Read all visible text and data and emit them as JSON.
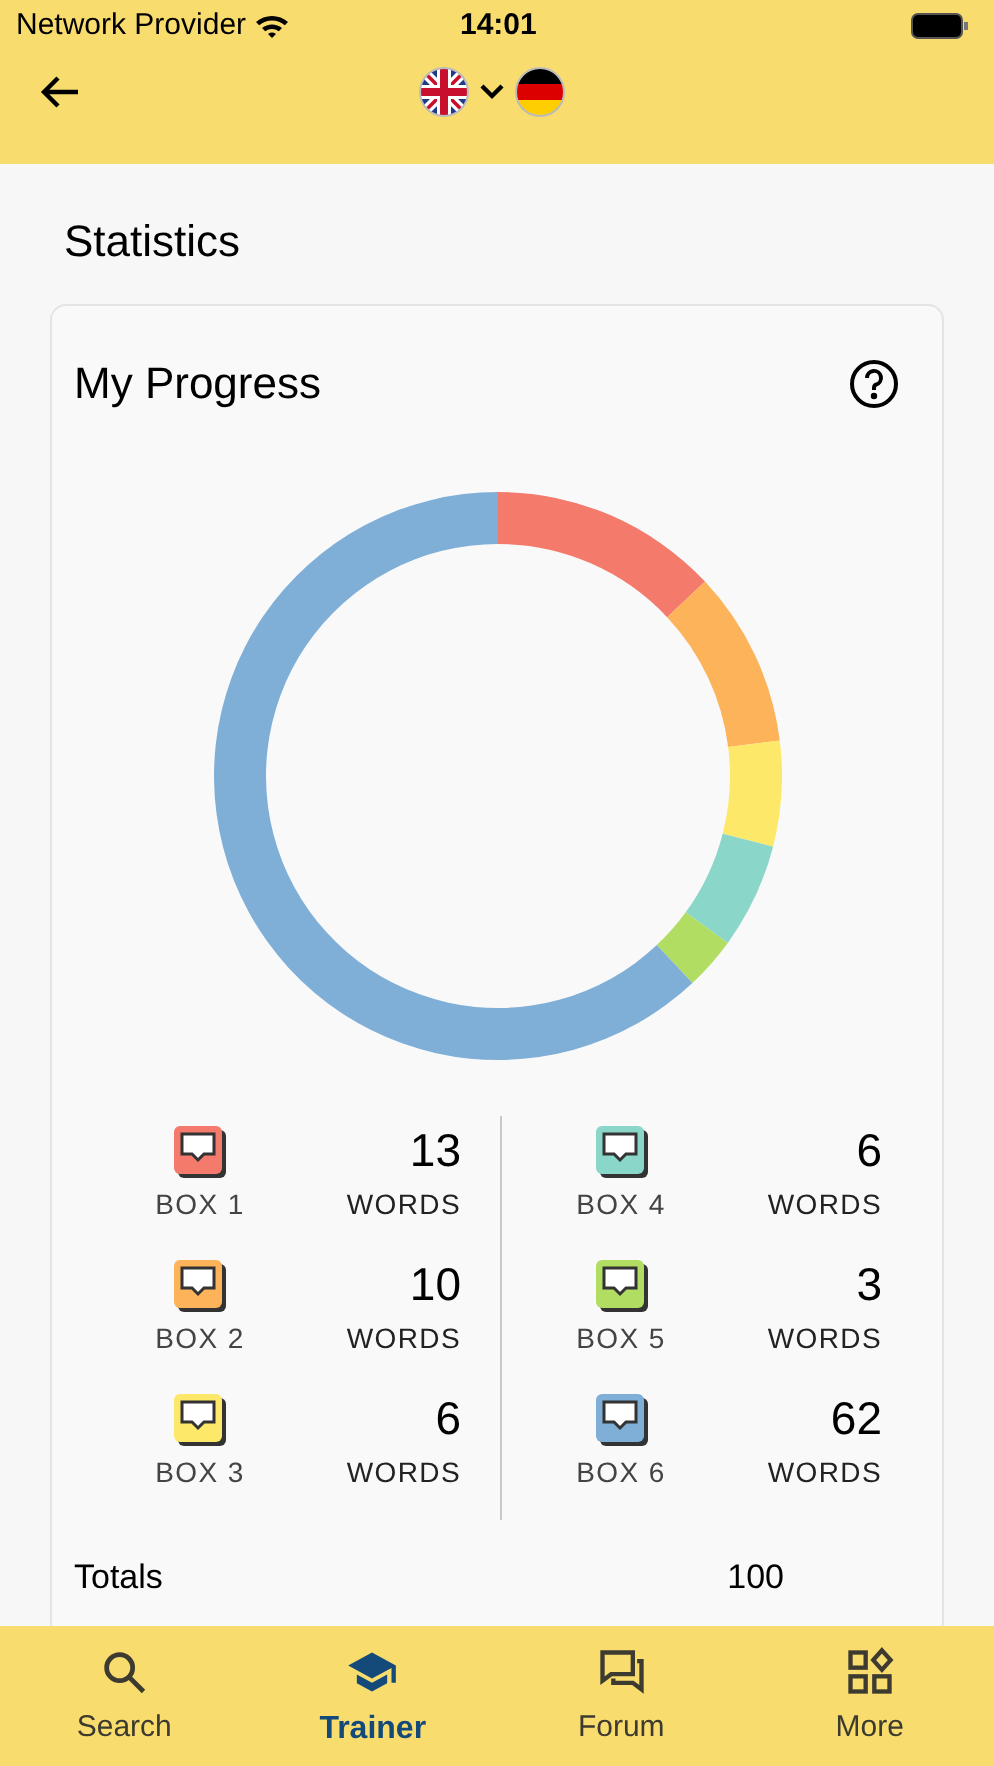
{
  "status_bar": {
    "carrier": "Network Provider",
    "time": "14:01"
  },
  "page_title": "Statistics",
  "card": {
    "title": "My Progress",
    "chart_data": {
      "type": "donut",
      "categories": [
        "BOX 1",
        "BOX 2",
        "BOX 3",
        "BOX 4",
        "BOX 5",
        "BOX 6"
      ],
      "values": [
        13,
        10,
        6,
        6,
        3,
        62
      ]
    },
    "boxes": [
      {
        "count": "13",
        "unit": "WORDS",
        "color": "#f47a6c"
      },
      {
        "count": "10",
        "unit": "WORDS",
        "color": "#fdb35a"
      },
      {
        "count": "6",
        "unit": "WORDS",
        "color": "#fde869"
      },
      {
        "count": "6",
        "unit": "WORDS",
        "color": "#8ad6c9"
      },
      {
        "count": "3",
        "unit": "WORDS",
        "color": "#b1dd62"
      },
      {
        "count": "62",
        "unit": "WORDS",
        "color": "#7fafd7"
      }
    ],
    "totals": {
      "label": "Totals",
      "value": "100"
    }
  },
  "tab_bar": [
    {
      "label": "Search",
      "kind": "search",
      "selected": false
    },
    {
      "label": "Trainer",
      "kind": "trainer",
      "selected": true
    },
    {
      "label": "Forum",
      "kind": "forum",
      "selected": false
    },
    {
      "label": "More",
      "kind": "more",
      "selected": false
    }
  ]
}
